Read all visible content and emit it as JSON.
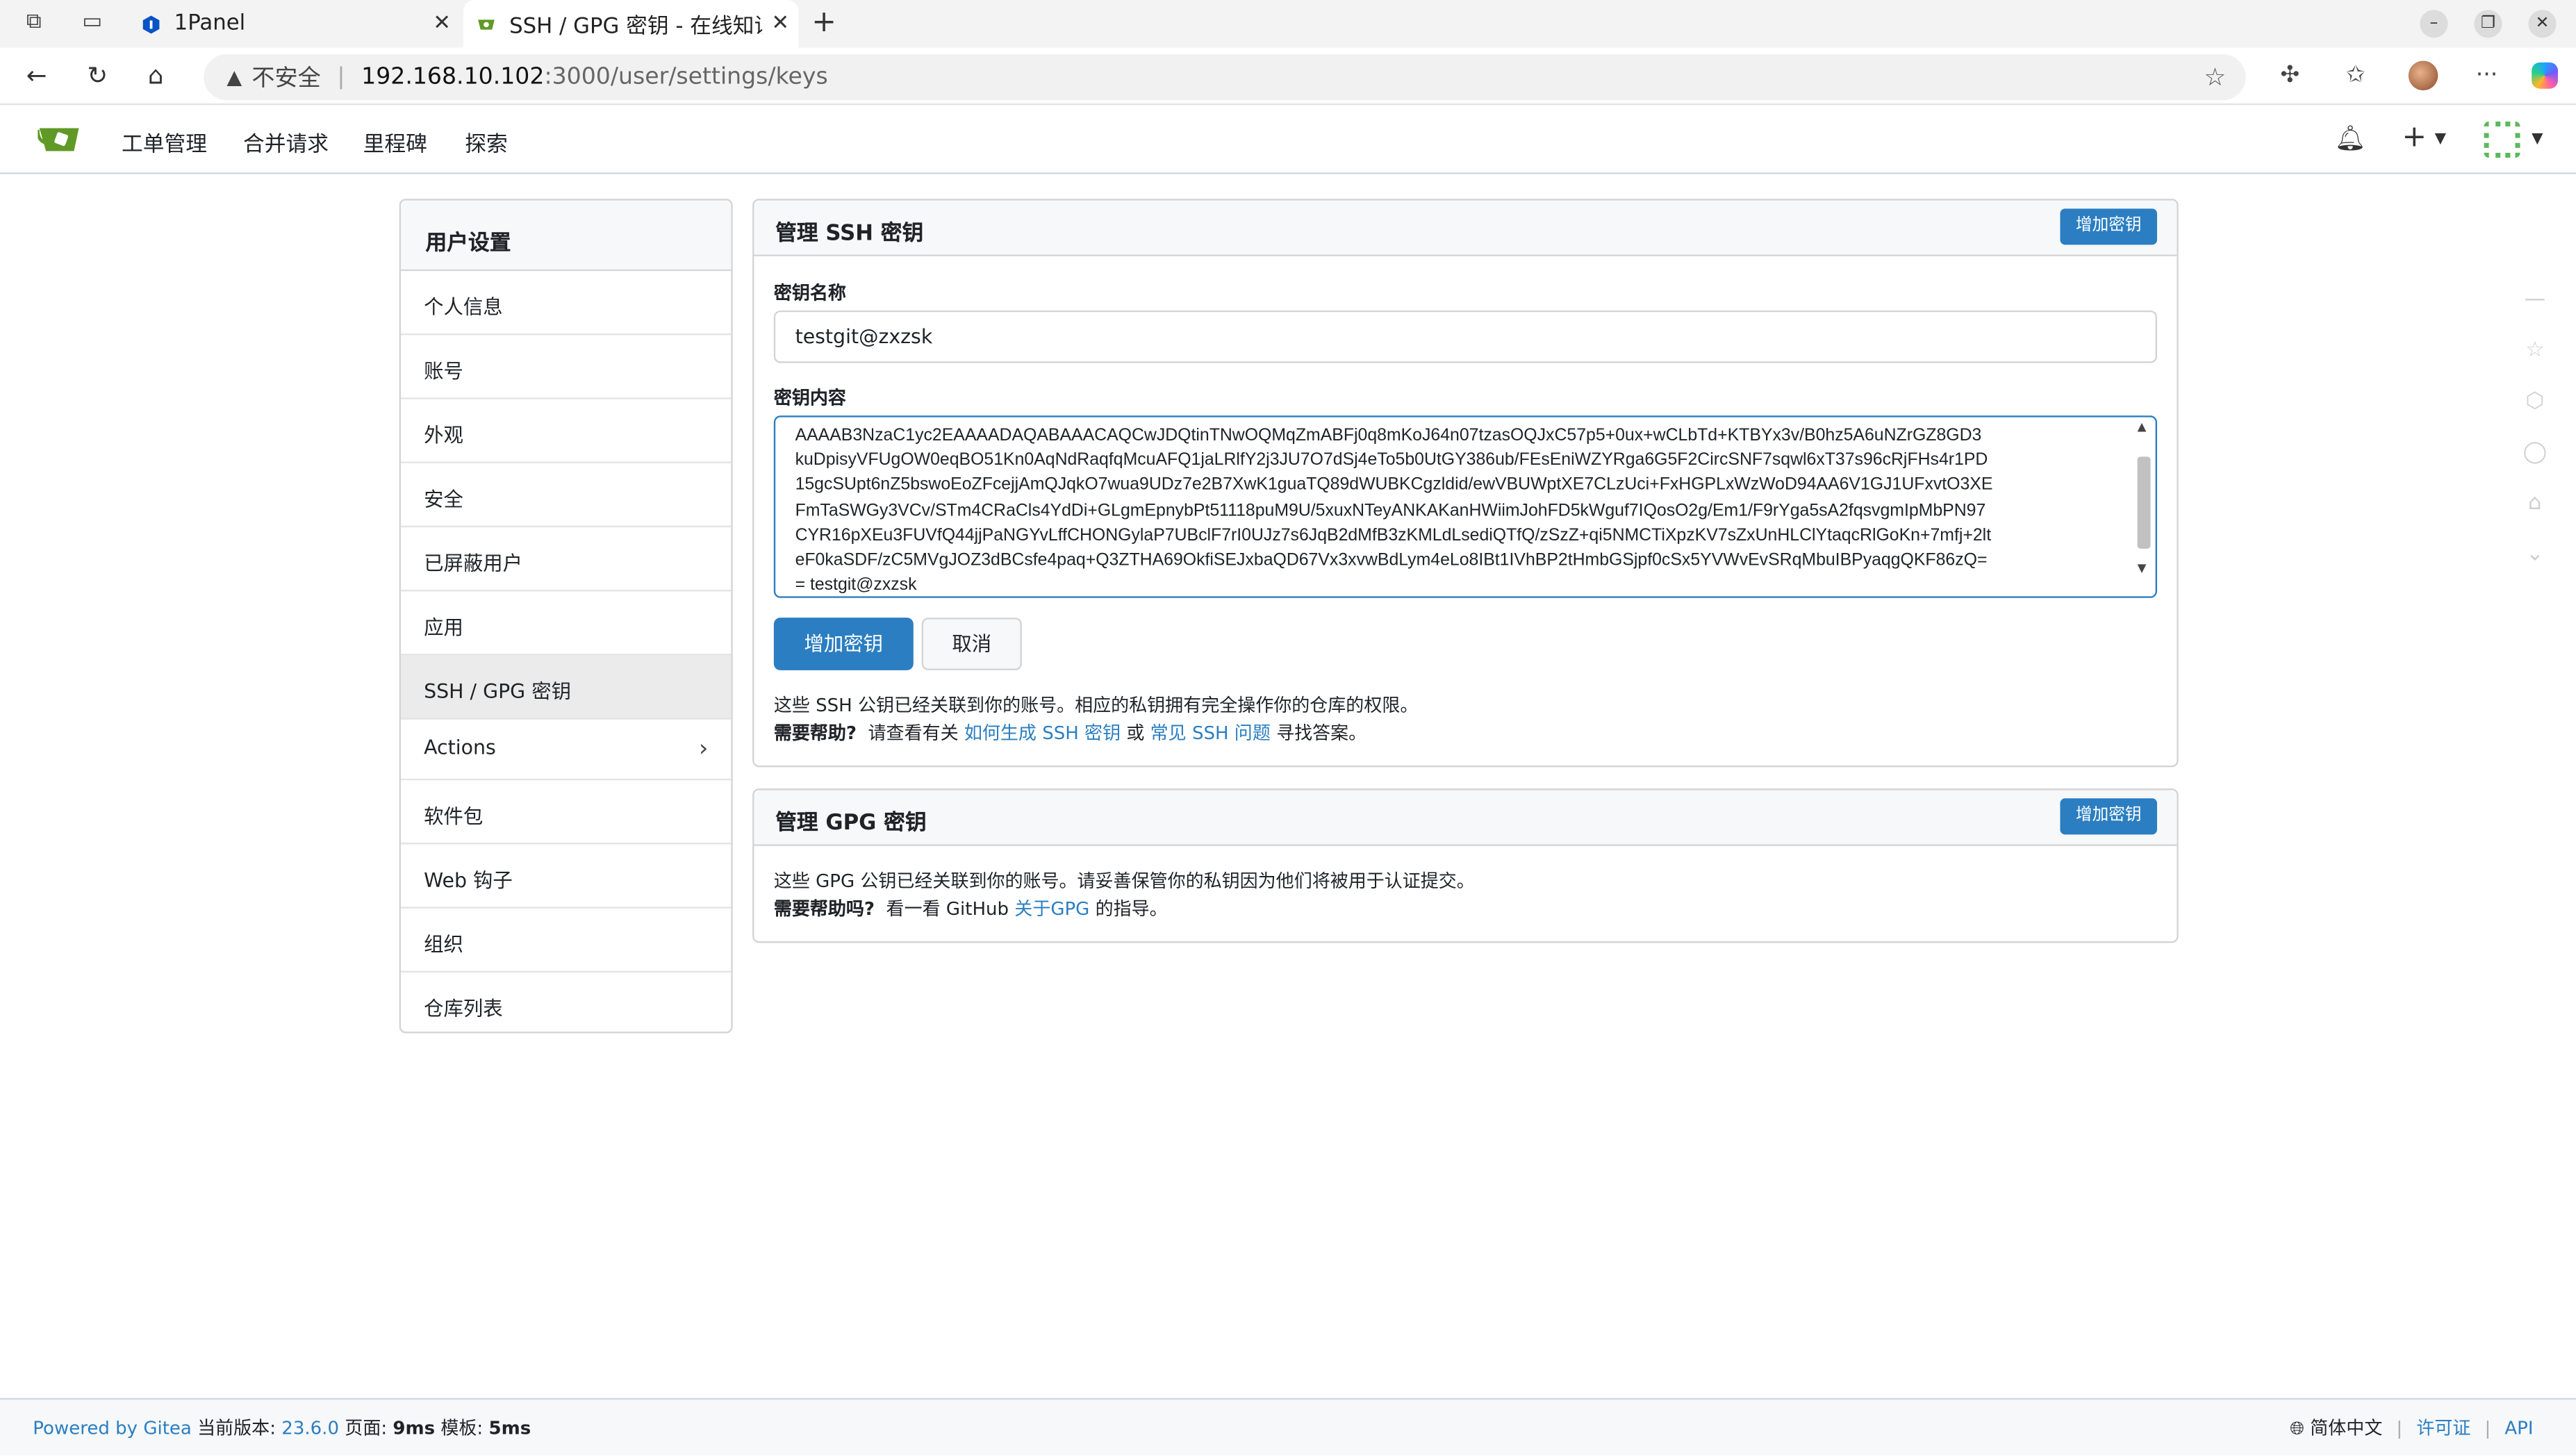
{
  "browser": {
    "tabs": [
      {
        "title": "1Panel",
        "active": false
      },
      {
        "title": "SSH / GPG 密钥 - 在线知识",
        "active": true
      }
    ],
    "address": {
      "security_label": "不安全",
      "host": "192.168.10.102",
      "path": ":3000/user/settings/keys"
    }
  },
  "nav": {
    "items": [
      "工单管理",
      "合并请求",
      "里程碑",
      "探索"
    ]
  },
  "sidebar": {
    "title": "用户设置",
    "items": [
      {
        "label": "个人信息"
      },
      {
        "label": "账号"
      },
      {
        "label": "外观"
      },
      {
        "label": "安全"
      },
      {
        "label": "已屏蔽用户"
      },
      {
        "label": "应用"
      },
      {
        "label": "SSH / GPG 密钥",
        "active": true
      },
      {
        "label": "Actions"
      },
      {
        "label": "软件包"
      },
      {
        "label": "Web 钩子"
      },
      {
        "label": "组织"
      },
      {
        "label": "仓库列表"
      }
    ]
  },
  "ssh": {
    "title": "管理 SSH 密钥",
    "add_button": "增加密钥",
    "name_label": "密钥名称",
    "name_value": "testgit@zxzsk",
    "content_label": "密钥内容",
    "content_lines": [
      "AAAAB3NzaC1yc2EAAAADAQABAAACAQCwJDQtinTNwOQMqZmABFj0q8mKoJ64n07tzasOQJxC57p5+0ux+wCLbTd+KTBYx3v/B0hz5A6uNZrGZ8GD3",
      "kuDpisyVFUgOW0eqBO51Kn0AqNdRaqfqMcuAFQ1jaLRlfY2j3JU7O7dSj4eTo5b0UtGY386ub/FEsEniWZYRga6G5F2CircSNF7sqwl6xT37s96cRjFHs4r1PD",
      "15gcSUpt6nZ5bswoEoZFcejjAmQJqkO7wua9UDz7e2B7XwK1guaTQ89dWUBKCgzldid/ewVBUWptXE7CLzUci+FxHGPLxWzWoD94AA6V1GJ1UFxvtO3XE",
      "FmTaSWGy3VCv/STm4CRaCls4YdDi+GLgmEpnybPt51118puM9U/5xuxNTeyANKAKanHWiimJohFD5kWguf7IQosO2g/Em1/F9rYga5sA2fqsvgmIpMbPN97",
      "CYR16pXEu3FUVfQ44jjPaNGYvLffCHONGylaP7UBclF7rI0UJz7s6JqB2dMfB3zKMLdLsediQTfQ/zSzZ+qi5NMCTiXpzKV7sZxUnHLClYtaqcRlGoKn+7mfj+2lt",
      "eF0kaSDF/zC5MVgJOZ3dBCsfe4paq+Q3ZTHA69OkfiSEJxbaQD67Vx3xvwBdLym4eLo8IBt1IVhBP2tHmbGSjpf0cSx5YVWvEvSRqMbuIBPyaqgQKF86zQ=",
      "= testgit@zxzsk"
    ],
    "submit_button": "增加密钥",
    "cancel_button": "取消",
    "info_text": "这些 SSH 公钥已经关联到你的账号。相应的私钥拥有完全操作你的仓库的权限。",
    "help_bold": "需要帮助?",
    "help_pre": "请查看有关",
    "help_link1": "如何生成 SSH 密钥",
    "help_mid": "或",
    "help_link2": "常见 SSH 问题",
    "help_post": "寻找答案。"
  },
  "gpg": {
    "title": "管理 GPG 密钥",
    "add_button": "增加密钥",
    "info_text": "这些 GPG 公钥已经关联到你的账号。请妥善保管你的私钥因为他们将被用于认证提交。",
    "help_bold": "需要帮助吗?",
    "help_pre": "看一看 GitHub",
    "help_link": "关于GPG",
    "help_post": "的指导。"
  },
  "footer": {
    "powered": "Powered by Gitea",
    "version_label": "当前版本:",
    "version": "23.6.0",
    "page_label": "页面:",
    "page_time": "9ms",
    "tmpl_label": "模板:",
    "tmpl_time": "5ms",
    "language": "简体中文",
    "license": "许可证",
    "api": "API"
  },
  "colors": {
    "accent": "#2b7ec1",
    "gitea_green": "#609926"
  }
}
